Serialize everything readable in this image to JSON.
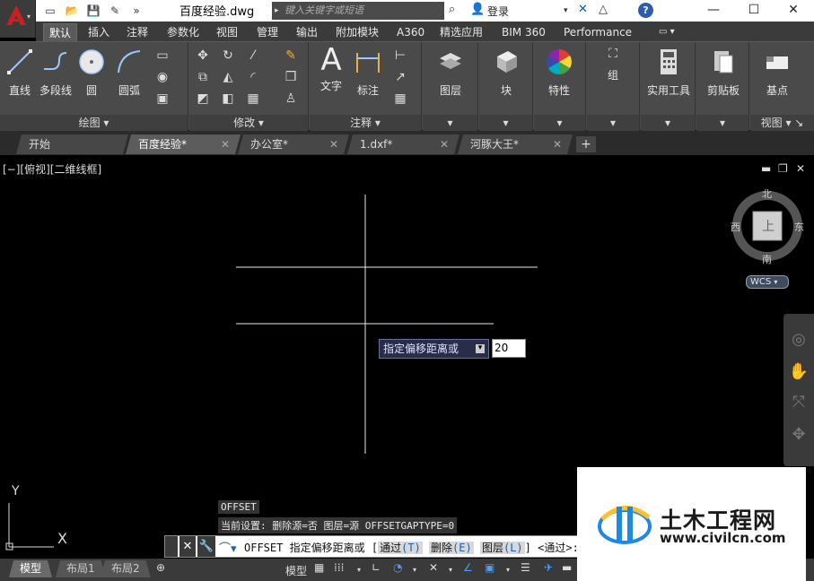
{
  "window": {
    "title": "百度经验.dwg",
    "search_placeholder": "键入关键字或短语",
    "login_label": "登录",
    "minimize": "—",
    "maximize": "☐",
    "close": "✕"
  },
  "ribbon": {
    "tabs": [
      {
        "label": "默认"
      },
      {
        "label": "插入"
      },
      {
        "label": "注释"
      },
      {
        "label": "参数化"
      },
      {
        "label": "视图"
      },
      {
        "label": "管理"
      },
      {
        "label": "输出"
      },
      {
        "label": "附加模块"
      },
      {
        "label": "A360"
      },
      {
        "label": "精选应用"
      },
      {
        "label": "BIM 360"
      },
      {
        "label": "Performance"
      }
    ],
    "draw": {
      "title": "绘图 ▾",
      "line": "直线",
      "polyline": "多段线",
      "circle": "圆",
      "arc": "圆弧"
    },
    "modify": {
      "title": "修改 ▾"
    },
    "annotation": {
      "title": "注释 ▾",
      "text": "文字",
      "dimension": "标注"
    },
    "layers": {
      "label": "图层"
    },
    "block": {
      "label": "块"
    },
    "properties": {
      "label": "特性"
    },
    "group": {
      "label": "组"
    },
    "utilities": {
      "label": "实用工具"
    },
    "clipboard": {
      "label": "剪贴板"
    },
    "basepoint": {
      "label": "基点"
    },
    "view": {
      "title": "视图 ▾ ↘"
    }
  },
  "file_tabs": [
    {
      "label": "开始"
    },
    {
      "label": "百度经验*"
    },
    {
      "label": "办公室*"
    },
    {
      "label": "1.dxf*"
    },
    {
      "label": "河豚大王*"
    }
  ],
  "viewport": {
    "label": "[−][俯视][二维线框]",
    "compass": {
      "north": "北",
      "south": "南",
      "east": "东",
      "west": "西",
      "wcs": "WCS"
    },
    "tooltip": "指定偏移距离或",
    "input_value": "20",
    "ucs_x": "X",
    "ucs_y": "Y"
  },
  "command": {
    "history_1": "OFFSET",
    "history_2": "当前设置: 删除源=否  图层=源  OFFSETGAPTYPE=0",
    "name": "OFFSET",
    "prompt": "指定偏移距离或",
    "opt_through": "通过",
    "opt_through_key": "(T)",
    "opt_erase": "删除",
    "opt_erase_key": "(E)",
    "opt_layer": "图层",
    "opt_layer_key": "(L)",
    "default": "<通过>:"
  },
  "status": {
    "layouts": [
      {
        "label": "模型"
      },
      {
        "label": "布局1"
      },
      {
        "label": "布局2"
      }
    ],
    "model": "模型"
  },
  "watermark": {
    "title": "土木工程网",
    "url": "www.civilcn.com"
  },
  "colors": {
    "accent": "#cc1f1f",
    "ribbon_bg": "#4a4a4a",
    "canvas_bg": "#000000"
  }
}
